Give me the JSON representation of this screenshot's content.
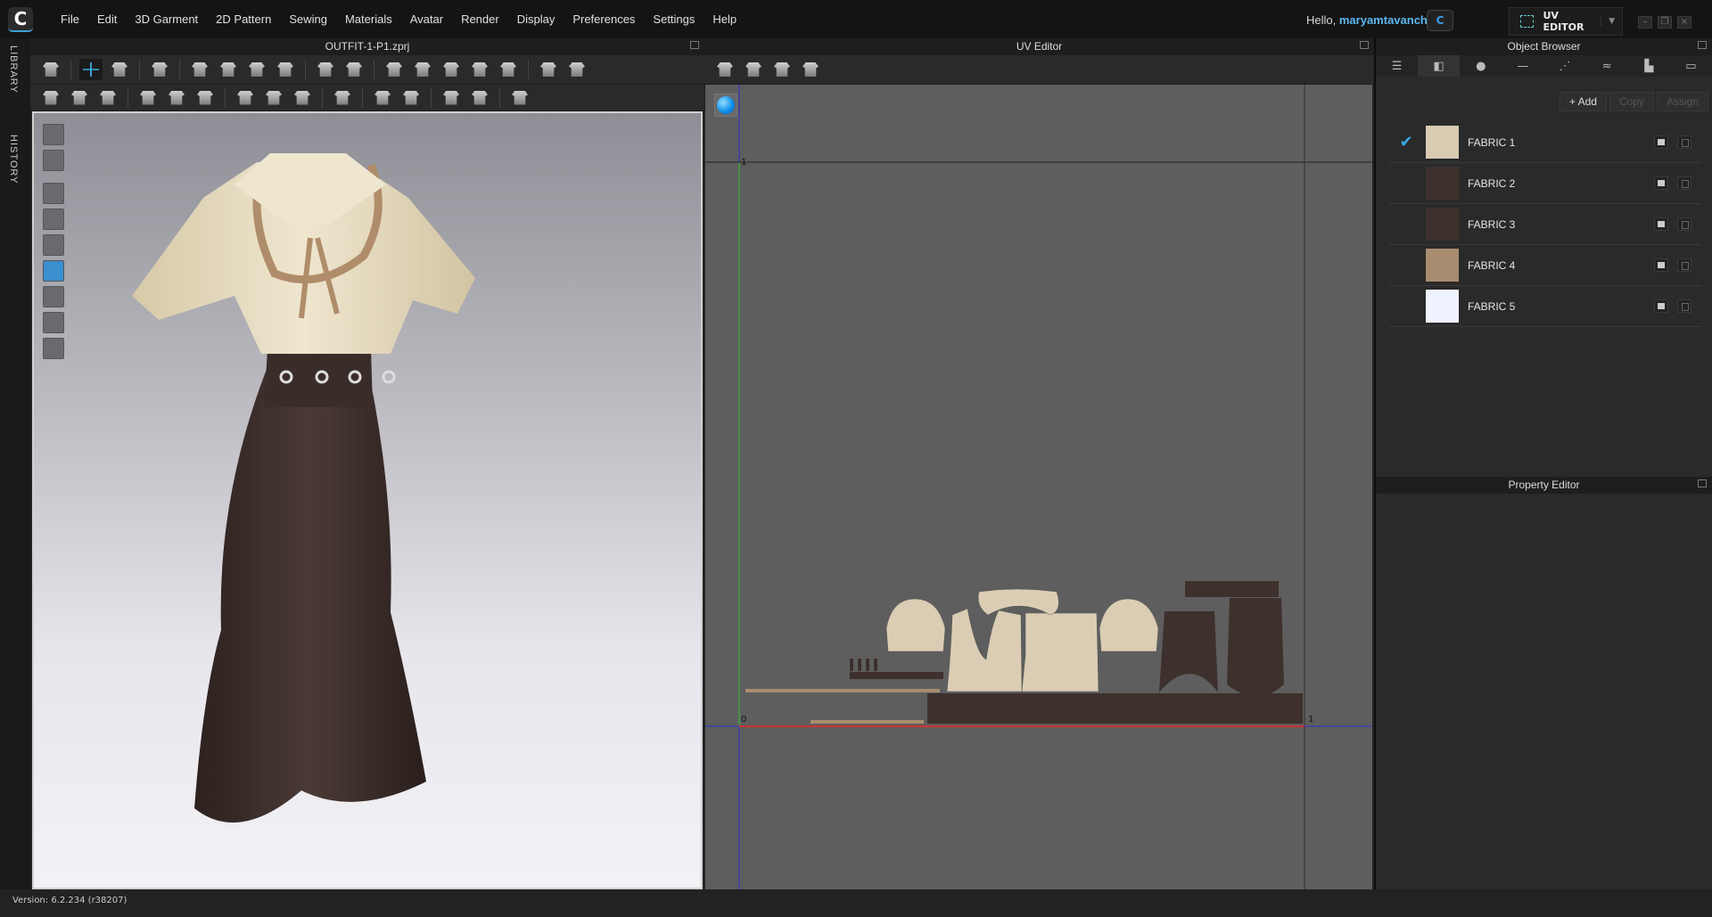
{
  "app": {
    "logo": "C",
    "menu": [
      "File",
      "Edit",
      "3D Garment",
      "2D Pattern",
      "Sewing",
      "Materials",
      "Avatar",
      "Render",
      "Display",
      "Preferences",
      "Settings",
      "Help"
    ],
    "greeting": "Hello,",
    "username": "maryamtavancheh",
    "cloud_icon": "C",
    "mode_label": "UV EDITOR"
  },
  "sidebar": {
    "library": "LIBRARY",
    "history": "HISTORY"
  },
  "panel3d": {
    "title": "OUTFIT-1-P1.zprj",
    "toolbar1": [
      "drop-arrow-icon",
      "|",
      "select-move-icon",
      "edit-pattern-icon",
      "|",
      "garment-icon",
      "|",
      "seam-tool-icon",
      "segment-sewing-icon",
      "free-sewing-icon",
      "tack-icon",
      "|",
      "pin-icon",
      "steam-icon",
      "|",
      "fold-icon",
      "garment-front-icon",
      "garment-split-icon",
      "garment-back-icon",
      "avatar-icon",
      "|",
      "show-garment-icon",
      "zipper-garment-icon"
    ],
    "toolbar2": [
      "edit-curvature-icon",
      "edit-curve-point-icon",
      "edit-line-icon",
      "|",
      "fabric-roll-icon",
      "graphic-icon",
      "texture-icon",
      "|",
      "button-icon",
      "button-select-icon",
      "buttonhole-icon",
      "|",
      "zipper-icon",
      "|",
      "puckering-icon",
      "piping-icon",
      "|",
      "topstitch-icon",
      "stitch-icon",
      "|",
      "measure-icon"
    ],
    "side_tools": [
      "avatar-display-icon",
      "garment-display-icon",
      "texture-view-icon",
      "brush-icon",
      "avatar-skin-icon",
      "uv-texture-icon",
      "shadow-icon",
      "avatar-pose-icon",
      "globe-icon"
    ]
  },
  "uv": {
    "title": "UV Editor",
    "toolbar": [
      "snapshot-uv-icon",
      "snapshot-pattern-icon",
      "move-pattern-icon",
      "arrange-pattern-icon"
    ],
    "axis_zero": "0",
    "axis_one_u": "1",
    "axis_one_v": "1"
  },
  "object_browser": {
    "title": "Object Browser",
    "tabs": [
      "list-icon",
      "fabric-icon",
      "button-icon",
      "piping-icon",
      "topstitch-icon",
      "puckering-icon",
      "graphic-icon",
      "zipper-icon"
    ],
    "add": "+ Add",
    "copy": "Copy",
    "assign": "Assign",
    "fabrics": [
      {
        "name": "FABRIC 1",
        "color": "#d9cbb2",
        "selected": true
      },
      {
        "name": "FABRIC 2",
        "color": "#3d302d",
        "selected": false
      },
      {
        "name": "FABRIC 3",
        "color": "#3d302d",
        "selected": false
      },
      {
        "name": "FABRIC 4",
        "color": "#a88c70",
        "selected": false
      },
      {
        "name": "FABRIC 5",
        "color": "#eff3fe",
        "selected": false
      }
    ]
  },
  "property_editor": {
    "title": "Property Editor"
  },
  "status": {
    "version": "Version: 6.2.234 (r38207)"
  }
}
